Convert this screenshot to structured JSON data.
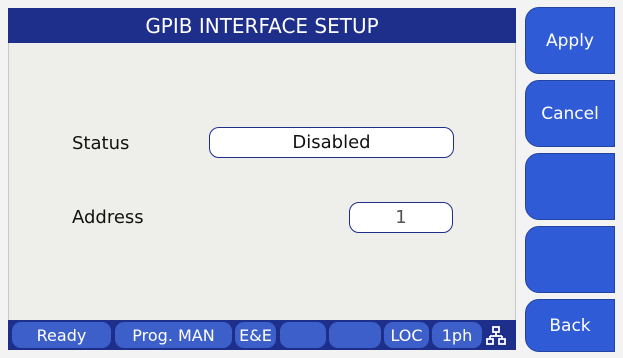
{
  "header": {
    "title": "GPIB INTERFACE SETUP"
  },
  "form": {
    "status_label": "Status",
    "status_value": "Disabled",
    "address_label": "Address",
    "address_value": "1"
  },
  "statusbar": {
    "items": [
      "Ready",
      "Prog. MAN",
      "E&E",
      "",
      "",
      "LOC",
      "1ph"
    ],
    "network_icon": "network-icon"
  },
  "softkeys": [
    "Apply",
    "Cancel",
    "",
    "",
    "Back"
  ],
  "colors": {
    "title_bg": "#1d2e8b",
    "softkey_bg": "#2f5bd6",
    "status_segment": "#3c5fc9"
  }
}
